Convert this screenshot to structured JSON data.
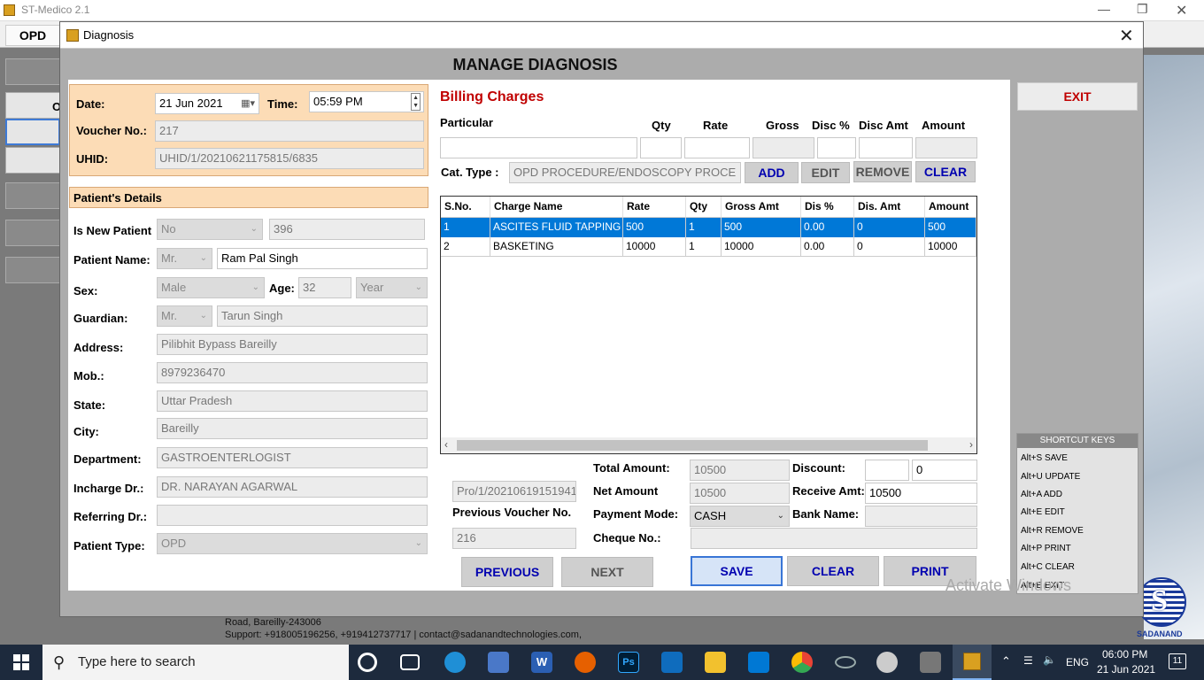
{
  "app_title": "ST-Medico 2.1",
  "menu": {
    "opd": "OPD",
    "side_partial": "O"
  },
  "dialog": {
    "title": "Diagnosis",
    "header": "MANAGE DIAGNOSIS",
    "exit_label": "EXIT"
  },
  "info": {
    "date_label": "Date:",
    "date_value": "21  Jun  2021",
    "time_label": "Time:",
    "time_value": "05:59 PM",
    "voucher_label": "Voucher No.:",
    "voucher_value": "217",
    "uhid_label": "UHID:",
    "uhid_value": "UHID/1/20210621175815/6835"
  },
  "patient": {
    "section_title": "Patient's Details",
    "is_new_label": "Is New Patient",
    "is_new_value": "No",
    "patient_id": "396",
    "name_label": "Patient Name:",
    "name_title": "Mr.",
    "name_value": "Ram Pal Singh",
    "sex_label": "Sex:",
    "sex_value": "Male",
    "age_label": "Age:",
    "age_value": "32",
    "age_unit": "Year",
    "guardian_label": "Guardian:",
    "guardian_title": "Mr.",
    "guardian_value": "Tarun Singh",
    "address_label": "Address:",
    "address_value": "Pilibhit Bypass Bareilly",
    "mob_label": "Mob.:",
    "mob_value": "8979236470",
    "state_label": "State:",
    "state_value": "Uttar Pradesh",
    "city_label": "City:",
    "city_value": "Bareilly",
    "dept_label": "Department:",
    "dept_value": "GASTROENTERLOGIST",
    "incharge_label": "Incharge Dr.:",
    "incharge_value": "DR. NARAYAN AGARWAL",
    "referring_label": "Referring Dr.:",
    "referring_value": "",
    "type_label": "Patient Type:",
    "type_value": "OPD"
  },
  "billing": {
    "title": "Billing Charges",
    "particular_label": "Particular",
    "qty_label": "Qty",
    "rate_label": "Rate",
    "gross_label": "Gross",
    "disc_pct_label": "Disc %",
    "disc_amt_label": "Disc Amt",
    "amount_label": "Amount",
    "cat_type_label": "Cat. Type :",
    "cat_type_value": "OPD PROCEDURE/ENDOSCOPY PROCE",
    "add": "ADD",
    "edit": "EDIT",
    "remove": "REMOVE",
    "clear": "CLEAR"
  },
  "grid": {
    "columns": [
      "S.No.",
      "Charge Name",
      "Rate",
      "Qty",
      "Gross Amt",
      "Dis %",
      "Dis. Amt",
      "Amount"
    ],
    "rows": [
      [
        "1",
        "ASCITES FLUID TAPPING",
        "500",
        "1",
        "500",
        "0.00",
        "0",
        "500"
      ],
      [
        "2",
        "BASKETING",
        "10000",
        "1",
        "10000",
        "0.00",
        "0",
        "10000"
      ]
    ]
  },
  "totals": {
    "prev_voucher_value": "Pro/1/20210619151941",
    "prev_voucher_label": "Previous Voucher No.",
    "prev_voucher_num": "216",
    "total_label": "Total Amount:",
    "total_value": "10500",
    "net_label": "Net Amount",
    "net_value": "10500",
    "payment_label": "Payment Mode:",
    "payment_value": "CASH",
    "cheque_label": "Cheque No.:",
    "cheque_value": "",
    "discount_label": "Discount:",
    "discount_pct": "",
    "discount_value": "0",
    "receive_label": "Receive Amt:",
    "receive_value": "10500",
    "bank_label": "Bank Name:",
    "bank_value": ""
  },
  "actions": {
    "previous": "PREVIOUS",
    "next": "NEXT",
    "save": "SAVE",
    "clear": "CLEAR",
    "print": "PRINT"
  },
  "shortcuts": {
    "title": "SHORTCUT KEYS",
    "items": [
      "Alt+S  SAVE",
      "Alt+U  UPDATE",
      "Alt+A  ADD",
      "Alt+E  EDIT",
      "Alt+R  REMOVE",
      "Alt+P  PRINT",
      "Alt+C  CLEAR",
      "Alt+E  EXIT"
    ]
  },
  "footer": {
    "address": "Road, Bareilly-243006",
    "support": "Support: +918005196256, +919412737717 | contact@sadanandtechnologies.com,",
    "logo_text": "SADANAND"
  },
  "watermark": "Activate Windows",
  "taskbar": {
    "search_placeholder": "Type here to search",
    "lang": "ENG",
    "time": "06:00 PM",
    "date": "21 Jun 2021",
    "notif_count": "11"
  }
}
